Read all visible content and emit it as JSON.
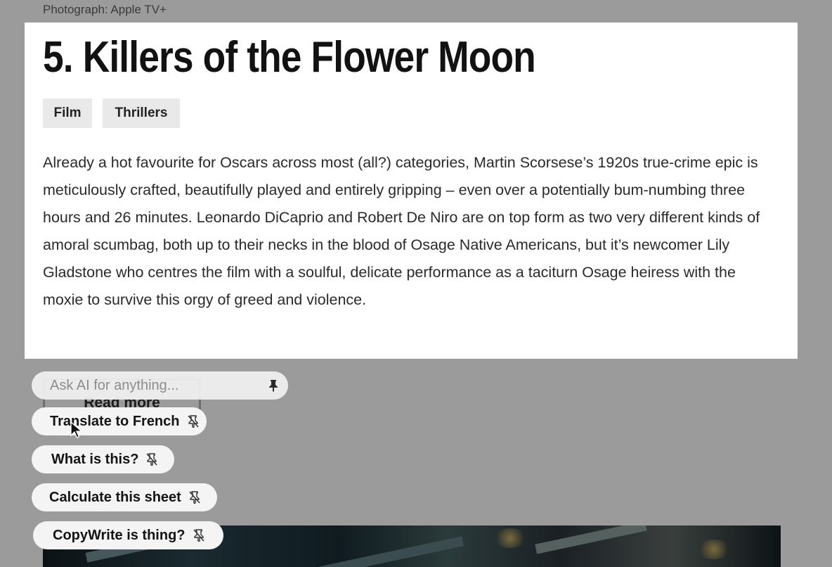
{
  "photo_credit": "Photograph: Apple TV+",
  "article": {
    "title": "5. Killers of the Flower Moon",
    "tags": [
      "Film",
      "Thrillers"
    ],
    "body": "Already a hot favourite for Oscars across most (all?) categories, Martin Scorsese’s 1920s true-crime epic is meticulously crafted, beautifully played and entirely gripping – even over a potentially bum-numbing three hours and 26 minutes. Leonardo DiCaprio and Robert De Niro are on top form as two very different kinds of amoral scumbag, both up to their necks in the blood of Osage Native Americans, but it’s newcomer Lily Gladstone who centres the film with a soulful, delicate performance as a taciturn Osage heiress with the moxie to survive this orgy of greed and violence.",
    "read_more_label": "Read more"
  },
  "ai_panel": {
    "input_placeholder": "Ask AI for anything...",
    "input_value": "",
    "input_pin_icon": "pin-icon",
    "suggestions": [
      {
        "label": "Translate to French",
        "icon": "unpin-icon"
      },
      {
        "label": "What is this?",
        "icon": "unpin-icon"
      },
      {
        "label": "Calculate this sheet",
        "icon": "unpin-icon"
      },
      {
        "label": "CopyWrite is thing?",
        "icon": "unpin-icon"
      }
    ]
  },
  "colors": {
    "overlay_background": "#9b9b9b",
    "card_background": "#ffffff",
    "tag_background": "#e9e9e9",
    "chip_background": "#f4f4f4"
  }
}
